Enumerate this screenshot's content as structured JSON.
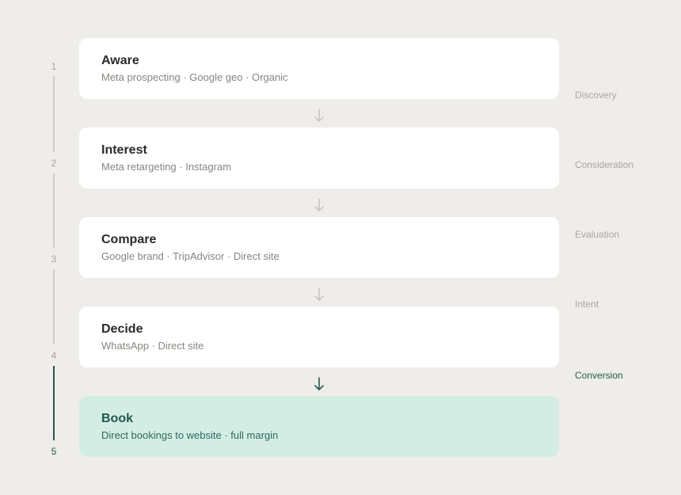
{
  "steps": [
    {
      "number": "1",
      "title": "Aware",
      "subtitle": "Meta prospecting · Google geo · Organic"
    },
    {
      "number": "2",
      "title": "Interest",
      "subtitle": "Meta retargeting · Instagram"
    },
    {
      "number": "3",
      "title": "Compare",
      "subtitle": "Google brand · TripAdvisor · Direct site"
    },
    {
      "number": "4",
      "title": "Decide",
      "subtitle": "WhatsApp · Direct site"
    },
    {
      "number": "5",
      "title": "Book",
      "subtitle": "Direct bookings to website · full margin"
    }
  ],
  "stages": [
    "Discovery",
    "Consideration",
    "Evaluation",
    "Intent",
    "Conversion"
  ],
  "colors": {
    "background": "#efede9",
    "card": "#ffffff",
    "final_card": "#d4ede4",
    "accent": "#1f5a4e",
    "muted": "#a8a59f",
    "rail": "#cfccc6"
  }
}
